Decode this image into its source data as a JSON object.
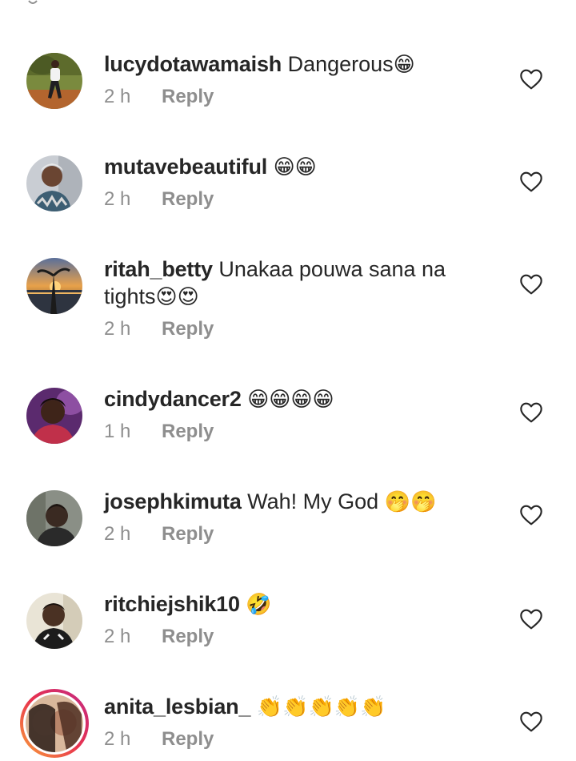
{
  "comments": [
    {
      "username": "lucydotawamaish",
      "text": " Dangerous",
      "emoji": "😁",
      "time": "2 h",
      "reply": "Reply",
      "avatar_icon": "user-photo-icon"
    },
    {
      "username": "mutavebeautiful",
      "text": " ",
      "emoji": "😁😁",
      "time": "2 h",
      "reply": "Reply",
      "avatar_icon": "user-photo-icon"
    },
    {
      "username": "ritah_betty",
      "text": " Unakaa pouwa sana na tights",
      "emoji": "😍😍",
      "time": "2 h",
      "reply": "Reply",
      "avatar_icon": "sunset-photo-icon"
    },
    {
      "username": "cindydancer2",
      "text": " ",
      "emoji": "😁😁😁😁",
      "time": "1 h",
      "reply": "Reply",
      "avatar_icon": "user-photo-icon"
    },
    {
      "username": "josephkimuta",
      "text": " Wah! My God ",
      "emoji": "🤭🤭",
      "time": "2 h",
      "reply": "Reply",
      "avatar_icon": "user-photo-icon"
    },
    {
      "username": "ritchiejshik10",
      "text": " ",
      "emoji": "🤣",
      "time": "2 h",
      "reply": "Reply",
      "avatar_icon": "user-photo-icon"
    },
    {
      "username": "anita_lesbian_",
      "text": " ",
      "emoji": "👏👏👏👏👏",
      "time": "2 h",
      "reply": "Reply",
      "avatar_icon": "user-photo-icon",
      "has_story": true
    }
  ],
  "like_icon": "heart-outline-icon",
  "colors": {
    "text": "#262626",
    "secondary": "#8e8e8e",
    "background": "#ffffff",
    "story_ring_start": "#f9a43a",
    "story_ring_end": "#c22a84"
  }
}
